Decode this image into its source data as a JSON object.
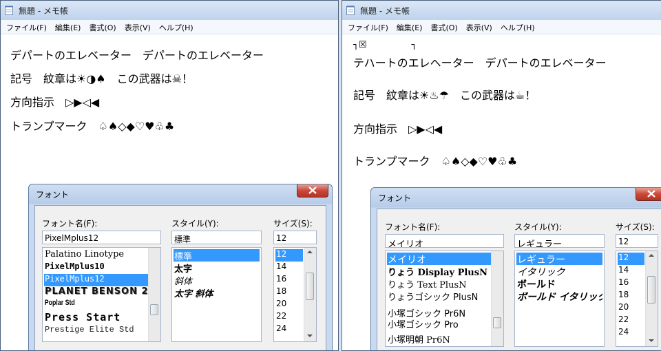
{
  "notepad_left": {
    "title": "無題 - メモ帳",
    "menu": [
      "ファイル(F)",
      "編集(E)",
      "書式(O)",
      "表示(V)",
      "ヘルプ(H)"
    ],
    "lines": [
      "デパートのエレベーター　デパートのエレベーター",
      "記号　紋章は☀◑♠　この武器は☠！",
      "方向指示　▷▶◁◀",
      "トランプマーク　♤♠◇◆♡♥♧♣"
    ]
  },
  "notepad_right": {
    "title": "無題 - メモ帳",
    "menu": [
      "ファイル(F)",
      "編集(E)",
      "書式(O)",
      "表示(V)",
      "ヘルプ(H)"
    ],
    "lines": [
      "┐☒　　　　　┐",
      "テハートのエレヘーター　デパートのエレベーター",
      "記号　紋章は☀♨☂　この武器は☕！",
      "方向指示　▷▶◁◀",
      "トランプマーク　♤♠◇◆♡♥♧♣"
    ]
  },
  "font_dialog_left": {
    "title": "フォント",
    "font_name_label": "フォント名(F):",
    "style_label": "スタイル(Y):",
    "size_label": "サイズ(S):",
    "font_name_value": "PixelMplus12",
    "style_value": "標準",
    "size_value": "12",
    "fonts": [
      "Palatino Linotype",
      "PixelMplus10",
      "PixelMplus12",
      "PLANET BENSON 2",
      "Poplar Std",
      "Press Start",
      "Prestige Elite Std"
    ],
    "selected_font": "PixelMplus12",
    "styles": [
      "標準",
      "太字",
      "斜体",
      "太字 斜体"
    ],
    "sizes": [
      "12",
      "14",
      "16",
      "18",
      "20",
      "22",
      "24"
    ]
  },
  "font_dialog_right": {
    "title": "フォント",
    "font_name_label": "フォント名(F):",
    "style_label": "スタイル(Y):",
    "size_label": "サイズ(S):",
    "font_name_value": "メイリオ",
    "style_value": "レギュラー",
    "size_value": "12",
    "fonts": [
      "メイリオ",
      "りょう Display PlusN",
      "りょう Text PlusN",
      "りょうゴシック PlusN",
      "小塚ゴシック Pr6N",
      "小塚ゴシック Pro",
      "小塚明朝 Pr6N"
    ],
    "selected_font": "メイリオ",
    "styles": [
      "レギュラー",
      "イタリック",
      "ボールド",
      "ボールド イタリック"
    ],
    "sizes": [
      "12",
      "14",
      "16",
      "18",
      "20",
      "22",
      "24"
    ]
  },
  "colors": {
    "selection": "#3399ff",
    "close_button": "#c9483a"
  }
}
